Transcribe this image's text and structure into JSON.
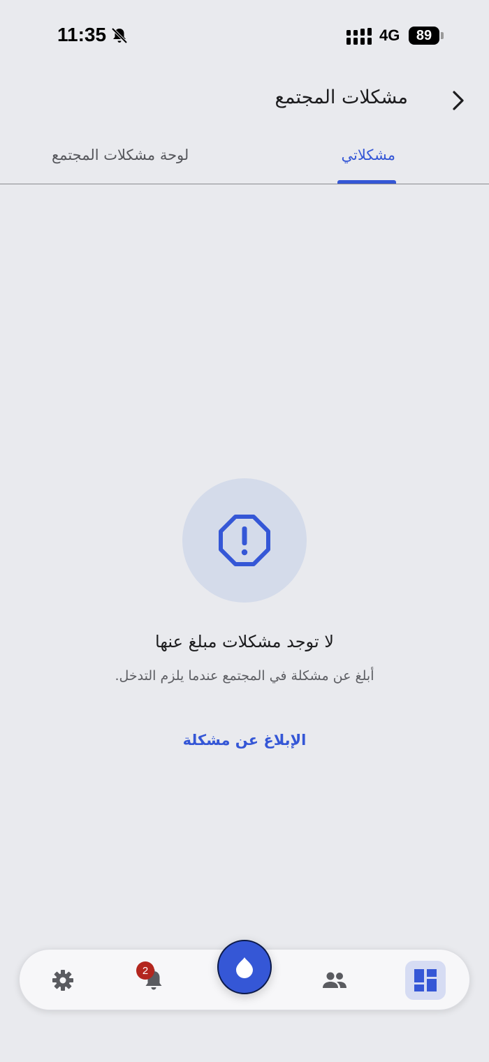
{
  "status_bar": {
    "time": "11:35",
    "network": "4G",
    "battery": "89"
  },
  "header": {
    "title": "مشكلات المجتمع",
    "back_icon": "chevron-right-icon"
  },
  "tabs": [
    {
      "label": "مشكلاتي",
      "active": true
    },
    {
      "label": "لوحة مشكلات المجتمع",
      "active": false
    }
  ],
  "empty_state": {
    "icon": "octagon-alert-icon",
    "title": "لا توجد مشكلات مبلغ عنها",
    "subtitle": "أبلغ عن مشكلة في المجتمع عندما يلزم التدخل.",
    "action_label": "الإبلاغ عن مشكلة"
  },
  "bottom_nav": {
    "items": [
      {
        "icon": "gear-icon"
      },
      {
        "icon": "bell-icon",
        "badge": "2"
      },
      {
        "icon": "drop-icon"
      },
      {
        "icon": "people-icon"
      },
      {
        "icon": "dashboard-icon",
        "active": true
      }
    ]
  },
  "colors": {
    "accent": "#3557d6",
    "background": "#e9eaee",
    "badge": "#b3261e"
  }
}
